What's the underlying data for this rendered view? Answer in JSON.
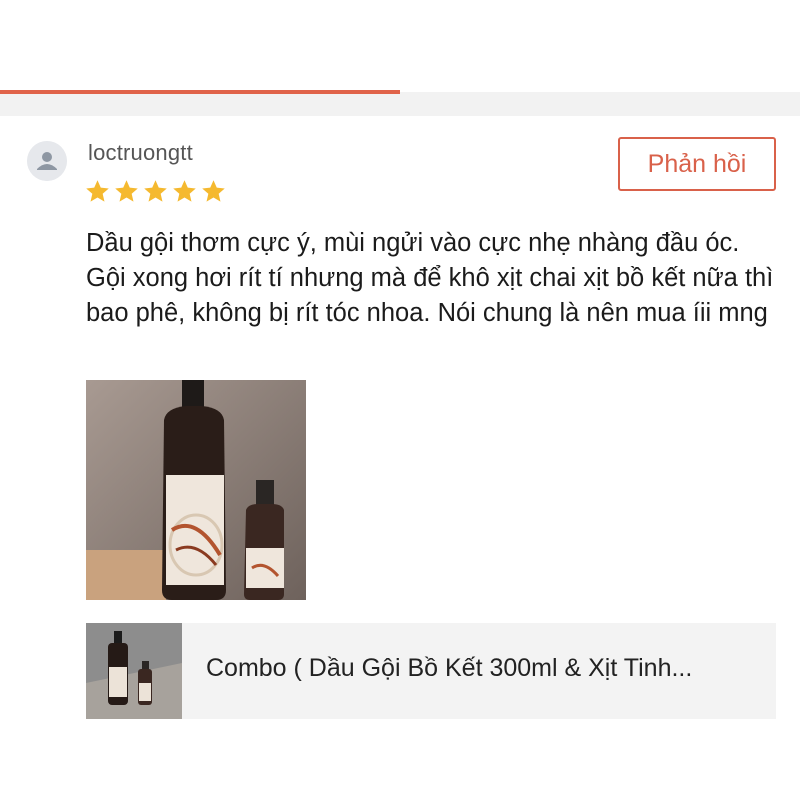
{
  "review": {
    "username": "loctruongtt",
    "rating": 5,
    "reply_label": "Phản hồi",
    "text": "Dầu gội thơm cực ý, mùi ngửi vào cực nhẹ nhàng đầu óc. Gội xong hơi rít tí nhưng mà để khô xịt chai xịt bồ kết nữa thì bao phê, không bị rít tóc nhoa. Nói chung là nên mua íii mng"
  },
  "product": {
    "name": "Combo ( Dầu Gội Bồ Kết 300ml & Xịt Tinh..."
  },
  "colors": {
    "accent": "#e0634a",
    "star": "#f5b92f",
    "card_bg": "#f3f3f3"
  }
}
